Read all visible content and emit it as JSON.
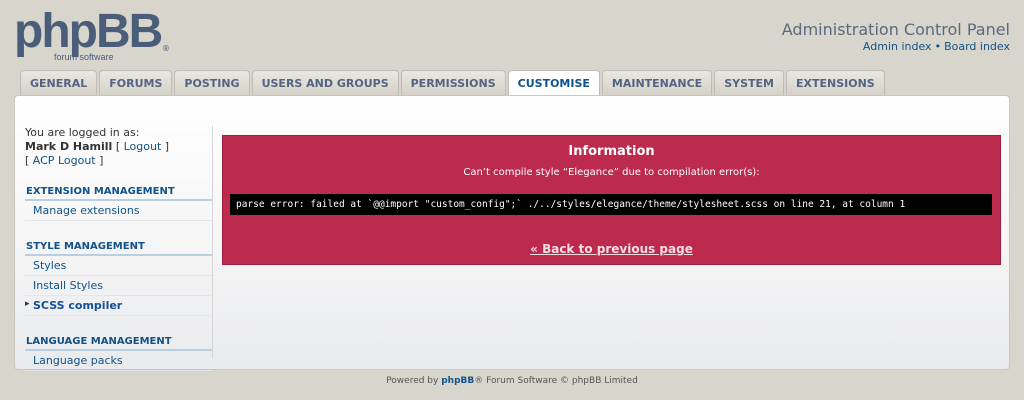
{
  "header": {
    "logo_main": "phpBB",
    "logo_sub": "forum software",
    "logo_reg": "®",
    "title": "Administration Control Panel",
    "links": [
      "Admin index",
      "Board index"
    ],
    "link_separator": "•"
  },
  "tabs": [
    {
      "label": "General",
      "active": false
    },
    {
      "label": "Forums",
      "active": false
    },
    {
      "label": "Posting",
      "active": false
    },
    {
      "label": "Users and Groups",
      "active": false
    },
    {
      "label": "Permissions",
      "active": false
    },
    {
      "label": "Customise",
      "active": true
    },
    {
      "label": "Maintenance",
      "active": false
    },
    {
      "label": "System",
      "active": false
    },
    {
      "label": "Extensions",
      "active": false
    }
  ],
  "sidebar": {
    "logged_in_label": "You are logged in as:",
    "username": "Mark D Hamill",
    "logout_label": "Logout",
    "acp_logout_label": "ACP Logout",
    "sections": [
      {
        "title": "Extension Management",
        "items": [
          {
            "label": "Manage extensions",
            "active": false
          }
        ]
      },
      {
        "title": "Style Management",
        "items": [
          {
            "label": "Styles",
            "active": false
          },
          {
            "label": "Install Styles",
            "active": false
          },
          {
            "label": "SCSS compiler",
            "active": true
          }
        ]
      },
      {
        "title": "Language Management",
        "items": [
          {
            "label": "Language packs",
            "active": false
          }
        ]
      }
    ]
  },
  "error": {
    "title": "Information",
    "message": "Can’t compile style “Elegance” due to compilation error(s):",
    "code": "parse error: failed at `@@import \"custom_config\";` ./../styles/elegance/theme/stylesheet.scss on line 21, at column 1",
    "back_link": "« Back to previous page"
  },
  "footer": {
    "prefix": "Powered by ",
    "brand": "phpBB",
    "suffix": "® Forum Software © phpBB Limited"
  },
  "colors": {
    "error_background": "#bc2a4d",
    "link": "#105289",
    "page_background": "#d8d5cc"
  }
}
